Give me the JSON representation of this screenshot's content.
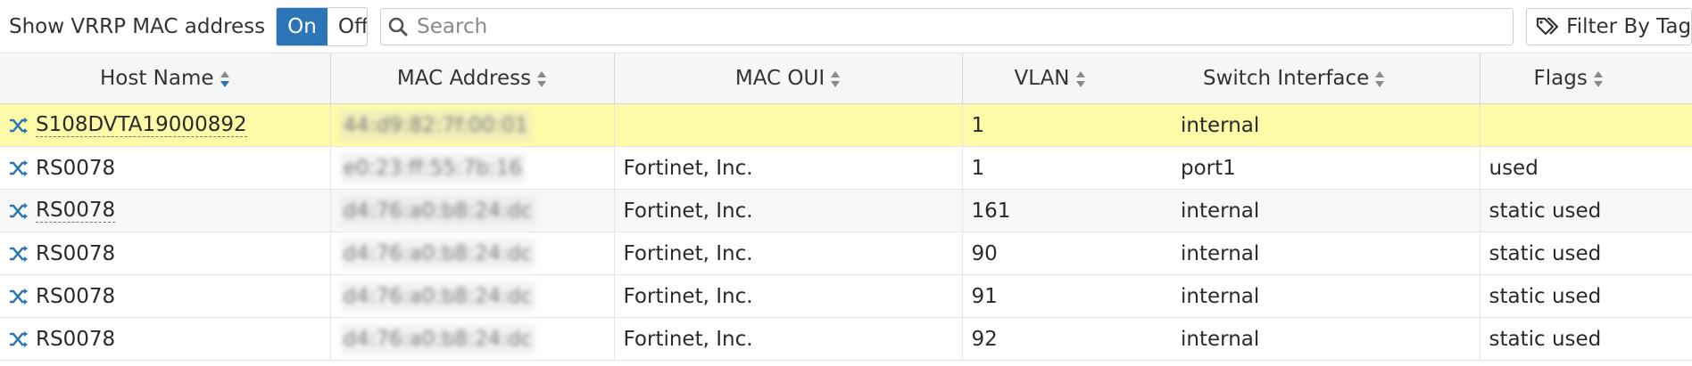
{
  "toolbar": {
    "vrrp_label": "Show VRRP MAC address",
    "toggle_on": "On",
    "toggle_off": "Off",
    "search_placeholder": "Search",
    "filter_label": "Filter By Tags"
  },
  "table": {
    "columns": [
      "Host Name",
      "MAC Address",
      "MAC OUI",
      "VLAN",
      "Switch Interface",
      "Flags"
    ],
    "rows": [
      {
        "host": "S108DVTA19000892",
        "mac": "44:d9:82:7f:00:01",
        "oui": "",
        "vlan": "1",
        "interface": "internal",
        "flags": ""
      },
      {
        "host": "RS0078",
        "mac": "e0:23:ff:55:7b:16",
        "oui": "Fortinet, Inc.",
        "vlan": "1",
        "interface": "port1",
        "flags": "used"
      },
      {
        "host": "RS0078",
        "mac": "d4:76:a0:b8:24:dc",
        "oui": "Fortinet, Inc.",
        "vlan": "161",
        "interface": "internal",
        "flags": "static used"
      },
      {
        "host": "RS0078",
        "mac": "d4:76:a0:b8:24:dc",
        "oui": "Fortinet, Inc.",
        "vlan": "90",
        "interface": "internal",
        "flags": "static used"
      },
      {
        "host": "RS0078",
        "mac": "d4:76:a0:b8:24:dc",
        "oui": "Fortinet, Inc.",
        "vlan": "91",
        "interface": "internal",
        "flags": "static used"
      },
      {
        "host": "RS0078",
        "mac": "d4:76:a0:b8:24:dc",
        "oui": "Fortinet, Inc.",
        "vlan": "92",
        "interface": "internal",
        "flags": "static used"
      }
    ]
  },
  "icons": {
    "search": "search-icon",
    "tags": "tags-icon",
    "host": "switch-icon",
    "sort": "sort-icon"
  },
  "colors": {
    "accent": "#2b76b9",
    "highlight_row": "#fdfaa8"
  }
}
